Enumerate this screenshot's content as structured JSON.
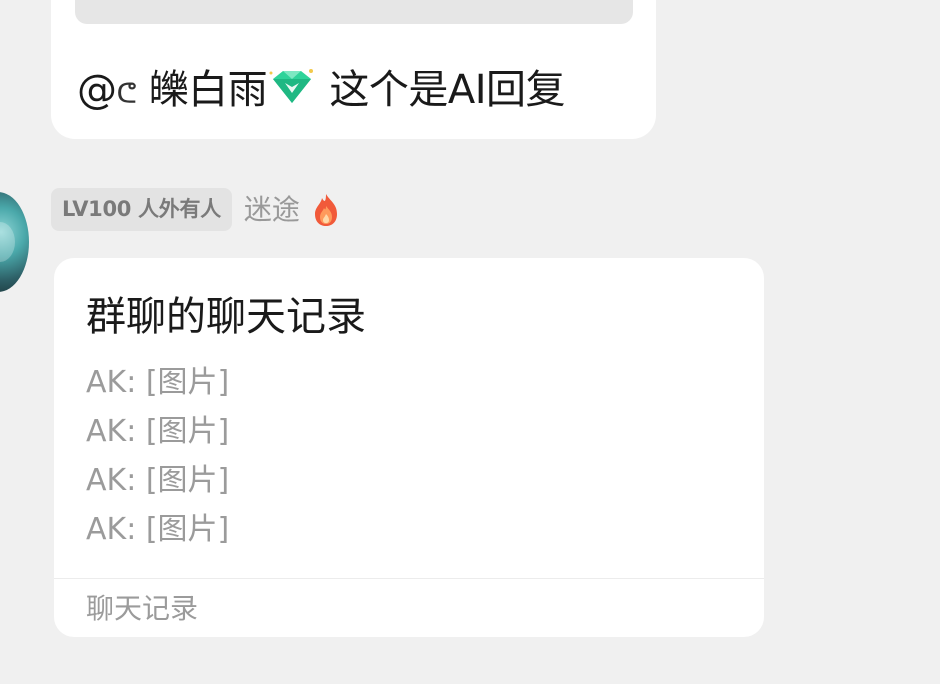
{
  "previous_message": {
    "text_prefix": "@",
    "glyph": "ᕦ",
    "mention_name": "皪白雨",
    "badge_icon": "gem-icon",
    "text": "这个是AI回复"
  },
  "sender": {
    "level_badge": "LV100 人外有人",
    "nickname": "迷途",
    "badge_icon": "fire-icon"
  },
  "forwarded_card": {
    "title": "群聊的聊天记录",
    "lines": [
      "AK: [图片]",
      "AK: [图片]",
      "AK: [图片]",
      "AK: [图片]"
    ],
    "footer": "聊天记录"
  },
  "colors": {
    "background": "#f0f0f0",
    "bubble": "#ffffff",
    "badge_bg": "#e3e3e3",
    "muted_text": "#9b9b9b",
    "primary_text": "#1a1a1a",
    "gem": "#2fd39a"
  }
}
